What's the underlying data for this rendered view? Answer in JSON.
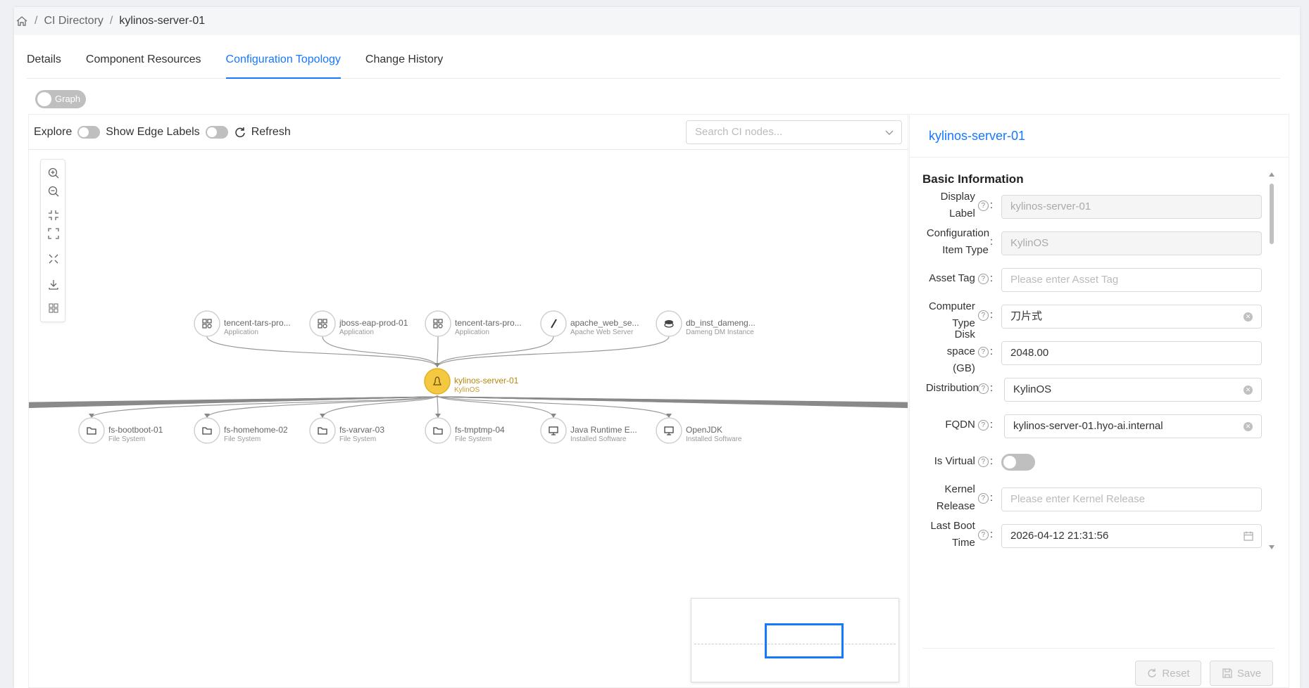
{
  "breadcrumb": {
    "home_icon": "home-icon",
    "items": [
      "CI Directory",
      "kylinos-server-01"
    ]
  },
  "tabs": [
    {
      "label": "Details",
      "active": false
    },
    {
      "label": "Component Resources",
      "active": false
    },
    {
      "label": "Configuration Topology",
      "active": true
    },
    {
      "label": "Change History",
      "active": false
    }
  ],
  "view_toggle": {
    "label": "Graph",
    "on": false
  },
  "toolbar": {
    "explore_label": "Explore",
    "explore_on": false,
    "edge_labels_label": "Show Edge Labels",
    "edge_labels_on": false,
    "refresh_label": "Refresh",
    "search_placeholder": "Search CI nodes..."
  },
  "graph": {
    "center": {
      "name": "kylinos-server-01",
      "type": "KylinOS",
      "icon": "linux-icon",
      "color": "#f5c842"
    },
    "upstream": [
      {
        "name": "tencent-tars-pro...",
        "type": "Application",
        "icon": "app-grid-icon"
      },
      {
        "name": "jboss-eap-prod-01",
        "type": "Application",
        "icon": "app-grid-icon"
      },
      {
        "name": "tencent-tars-pro...",
        "type": "Application",
        "icon": "app-grid-icon"
      },
      {
        "name": "apache_web_se...",
        "type": "Apache Web Server",
        "icon": "feather-icon"
      },
      {
        "name": "db_inst_dameng...",
        "type": "Dameng DM Instance",
        "icon": "database-icon"
      }
    ],
    "downstream": [
      {
        "name": "fs-bootboot-01",
        "type": "File System",
        "icon": "folder-icon"
      },
      {
        "name": "fs-homehome-02",
        "type": "File System",
        "icon": "folder-icon"
      },
      {
        "name": "fs-varvar-03",
        "type": "File System",
        "icon": "folder-icon"
      },
      {
        "name": "fs-tmptmp-04",
        "type": "File System",
        "icon": "folder-icon"
      },
      {
        "name": "Java Runtime E...",
        "type": "Installed Software",
        "icon": "software-icon"
      },
      {
        "name": "OpenJDK",
        "type": "Installed Software",
        "icon": "software-icon"
      }
    ]
  },
  "detail": {
    "title": "kylinos-server-01",
    "section": "Basic Information",
    "fields": [
      {
        "label": "Display Label",
        "help": true,
        "value": "kylinos-server-01",
        "placeholder": "",
        "disabled": true,
        "clearable": false
      },
      {
        "label": "Configuration Item Type",
        "help": false,
        "value": "KylinOS",
        "placeholder": "",
        "disabled": true,
        "clearable": false
      },
      {
        "label": "Asset Tag",
        "help": true,
        "value": "",
        "placeholder": "Please enter Asset Tag",
        "disabled": false,
        "clearable": false
      },
      {
        "label": "Computer Type",
        "help": true,
        "value": "刀片式",
        "placeholder": "",
        "disabled": false,
        "clearable": true
      },
      {
        "label": "Disk space (GB)",
        "help": true,
        "value": "2048.00",
        "placeholder": "",
        "disabled": false,
        "clearable": false
      },
      {
        "label": "Distribution",
        "help": true,
        "value": "KylinOS",
        "placeholder": "",
        "disabled": false,
        "clearable": true
      },
      {
        "label": "FQDN",
        "help": true,
        "value": "kylinos-server-01.hyo-ai.internal",
        "placeholder": "",
        "disabled": false,
        "clearable": true
      },
      {
        "label": "Is Virtual",
        "help": true,
        "switch": true,
        "on": false
      },
      {
        "label": "Kernel Release",
        "help": true,
        "value": "",
        "placeholder": "Please enter Kernel Release",
        "disabled": false,
        "clearable": false
      },
      {
        "label": "Last Boot Time",
        "help": true,
        "value": "2026-04-12 21:31:56",
        "placeholder": "",
        "disabled": false,
        "calendar": true
      }
    ],
    "reset_label": "Reset",
    "save_label": "Save"
  },
  "colors": {
    "accent": "#1677ff",
    "center_node": "#f5c842",
    "edge": "#999999"
  }
}
